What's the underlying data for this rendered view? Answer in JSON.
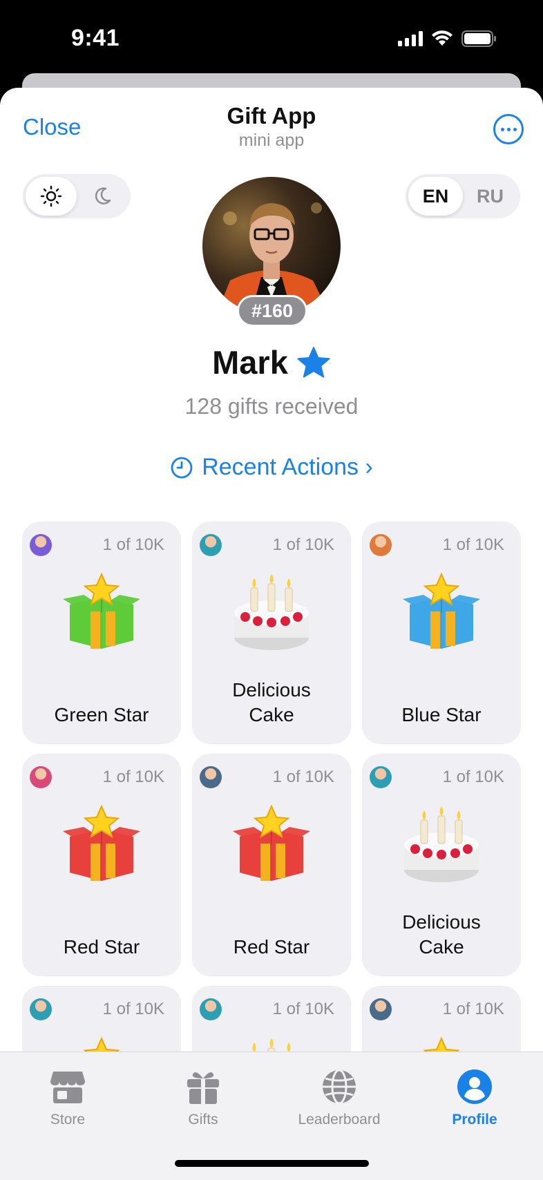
{
  "status_bar": {
    "time": "9:41"
  },
  "header": {
    "close_label": "Close",
    "title": "Gift App",
    "subtitle": "mini app",
    "more_icon": "ellipsis-circle-icon"
  },
  "theme_toggle": {
    "options": [
      "sun-icon",
      "moon-icon"
    ],
    "selected": "sun-icon"
  },
  "language_toggle": {
    "options": [
      "EN",
      "RU"
    ],
    "selected": "EN"
  },
  "profile": {
    "rank": "#160",
    "name": "Mark",
    "badge_icon": "star-icon",
    "gifts_received": "128 gifts received"
  },
  "recent_actions": {
    "label": "Recent Actions ›",
    "icon": "clock-icon"
  },
  "gifts": [
    {
      "name": "Green Star",
      "edition": "1 of 10K",
      "kind": "star-box",
      "color": "#5ecb3a"
    },
    {
      "name": "Delicious Cake",
      "edition": "1 of 10K",
      "kind": "cake",
      "color": "#e0e0e0"
    },
    {
      "name": "Blue Star",
      "edition": "1 of 10K",
      "kind": "star-box",
      "color": "#3ea7e8"
    },
    {
      "name": "Red Star",
      "edition": "1 of 10K",
      "kind": "star-box",
      "color": "#e8413d"
    },
    {
      "name": "Red Star",
      "edition": "1 of 10K",
      "kind": "star-box",
      "color": "#e8413d"
    },
    {
      "name": "Delicious Cake",
      "edition": "1 of 10K",
      "kind": "cake",
      "color": "#e0e0e0"
    },
    {
      "name": "",
      "edition": "1 of 10K",
      "kind": "star-box",
      "color": "#5ecb3a"
    },
    {
      "name": "",
      "edition": "1 of 10K",
      "kind": "cake",
      "color": "#e0e0e0"
    },
    {
      "name": "",
      "edition": "1 of 10K",
      "kind": "star-box",
      "color": "#3ea7e8"
    }
  ],
  "tabbar": {
    "tabs": [
      {
        "label": "Store",
        "icon": "store-icon"
      },
      {
        "label": "Gifts",
        "icon": "gift-icon"
      },
      {
        "label": "Leaderboard",
        "icon": "globe-icon"
      },
      {
        "label": "Profile",
        "icon": "person-icon"
      }
    ],
    "active": "Profile"
  },
  "colors": {
    "accent": "#1a82e6",
    "secondary_text": "#8e8e93",
    "card_bg": "#efeff4"
  }
}
